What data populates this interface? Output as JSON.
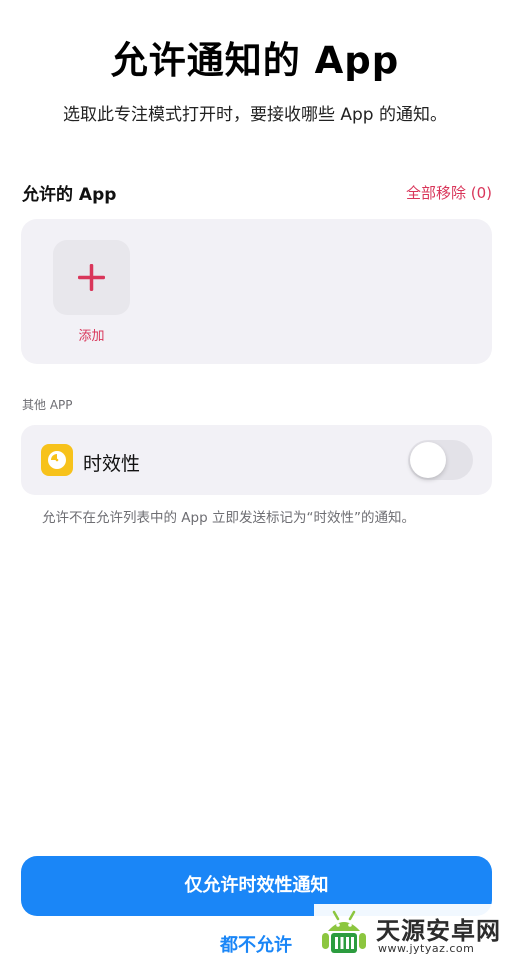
{
  "header": {
    "title": "允许通知的 App",
    "subtitle": "选取此专注模式打开时，要接收哪些 App 的通知。"
  },
  "allowed_apps": {
    "section_title": "允许的 App",
    "remove_all_label": "全部移除 (0)",
    "add_label": "添加"
  },
  "other_apps": {
    "section_label": "其他 APP",
    "time_sensitive_label": "时效性",
    "toggle_state": "off",
    "footnote": "允许不在允许列表中的 App 立即发送标记为“时效性”的通知。"
  },
  "actions": {
    "primary_label": "仅允许时效性通知",
    "secondary_label": "都不允许"
  },
  "watermark": {
    "name": "天源安卓网",
    "url": "www.jytyaz.com"
  },
  "colors": {
    "accent_red": "#d9365a",
    "primary_blue": "#1a86f7",
    "card_bg": "#f2f1f6",
    "icon_yellow": "#f7c21b"
  },
  "icons": {
    "add": "plus-icon",
    "time_sensitive": "clock-icon"
  }
}
